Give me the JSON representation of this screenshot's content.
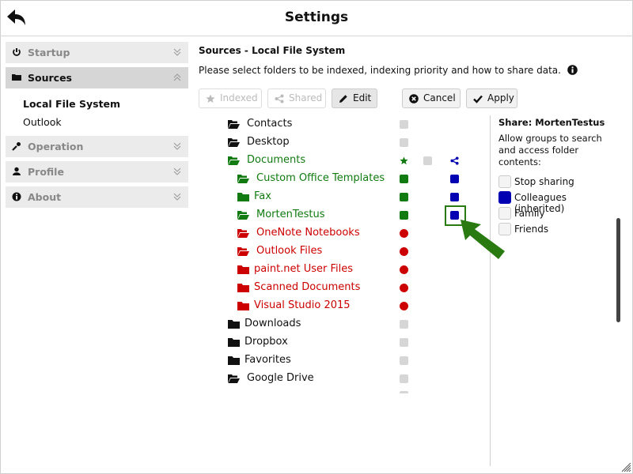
{
  "header": {
    "title": "Settings",
    "back_icon": "reply-arrow-icon"
  },
  "sidebar": {
    "sections": [
      {
        "label": "Startup",
        "icon": "power-icon",
        "expanded": false
      },
      {
        "label": "Sources",
        "icon": "folder-icon",
        "expanded": true,
        "children": [
          {
            "label": "Local File System",
            "selected": true
          },
          {
            "label": "Outlook",
            "selected": false
          }
        ]
      },
      {
        "label": "Operation",
        "icon": "wrench-icon",
        "expanded": false
      },
      {
        "label": "Profile",
        "icon": "user-icon",
        "expanded": false
      },
      {
        "label": "About",
        "icon": "info-icon",
        "expanded": false
      }
    ]
  },
  "main": {
    "title": "Sources - Local File System",
    "description": "Please select folders to be indexed, indexing priority and how to share data.",
    "toolbar": {
      "indexed": "Indexed",
      "shared": "Shared",
      "edit": "Edit",
      "cancel": "Cancel",
      "apply": "Apply"
    },
    "folders": [
      {
        "name": "Contacts",
        "level": 0,
        "color": "#111111",
        "open": true,
        "index": "grey",
        "share": ""
      },
      {
        "name": "Desktop",
        "level": 0,
        "color": "#111111",
        "open": true,
        "index": "grey",
        "share": ""
      },
      {
        "name": "Documents",
        "level": 0,
        "color": "#117a11",
        "open": true,
        "index": "star",
        "mid": "grey",
        "share": "share-icon"
      },
      {
        "name": "Custom Office Templates",
        "level": 1,
        "color": "#117a11",
        "open": true,
        "index": "green",
        "share": "blue"
      },
      {
        "name": "Fax",
        "level": 1,
        "color": "#117a11",
        "open": false,
        "index": "green",
        "share": "blue"
      },
      {
        "name": "MortenTestus",
        "level": 1,
        "color": "#117a11",
        "open": true,
        "index": "green",
        "share": "blue",
        "highlighted": true
      },
      {
        "name": "OneNote Notebooks",
        "level": 1,
        "color": "#cc0000",
        "open": true,
        "index": "red",
        "share": ""
      },
      {
        "name": "Outlook Files",
        "level": 1,
        "color": "#cc0000",
        "open": true,
        "index": "red",
        "share": ""
      },
      {
        "name": "paint.net User Files",
        "level": 1,
        "color": "#cc0000",
        "open": false,
        "index": "red",
        "share": ""
      },
      {
        "name": "Scanned Documents",
        "level": 1,
        "color": "#cc0000",
        "open": false,
        "index": "red",
        "share": ""
      },
      {
        "name": "Visual Studio 2015",
        "level": 1,
        "color": "#cc0000",
        "open": false,
        "index": "red",
        "share": ""
      },
      {
        "name": "Downloads",
        "level": 0,
        "color": "#111111",
        "open": false,
        "index": "grey",
        "share": ""
      },
      {
        "name": "Dropbox",
        "level": 0,
        "color": "#111111",
        "open": false,
        "index": "grey",
        "share": ""
      },
      {
        "name": "Favorites",
        "level": 0,
        "color": "#111111",
        "open": false,
        "index": "grey",
        "share": ""
      },
      {
        "name": "Google Drive",
        "level": 0,
        "color": "#111111",
        "open": true,
        "index": "grey",
        "share": ""
      }
    ]
  },
  "share_panel": {
    "title": "Share: MortenTestus",
    "description": "Allow groups to search and access folder contents:",
    "options": [
      {
        "label": "Stop sharing",
        "checked": false
      },
      {
        "label": "Colleagues (inherited)",
        "checked": true
      },
      {
        "label": "Family",
        "checked": false
      },
      {
        "label": "Friends",
        "checked": false
      }
    ]
  },
  "colors": {
    "green": "#117a11",
    "red": "#cc0000",
    "blue": "#0000b3",
    "grey": "#d6d6d6"
  }
}
